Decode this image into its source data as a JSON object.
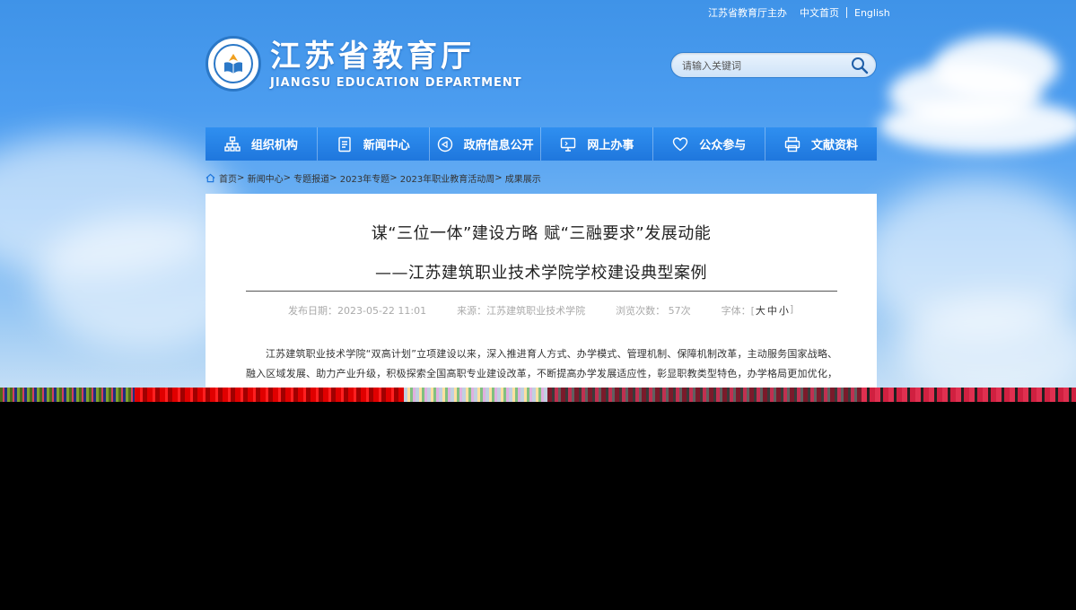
{
  "topbar": {
    "host": "江苏省教育厅主办",
    "chinese_home": "中文首页",
    "english": "English"
  },
  "logo": {
    "name_cn": "江苏省教育厅",
    "name_en": "JIANGSU EDUCATION DEPARTMENT"
  },
  "search": {
    "placeholder": "请输入关键词",
    "icon": "search-icon"
  },
  "nav": {
    "items": [
      {
        "label": "组织机构",
        "icon": "org-chart-icon"
      },
      {
        "label": "新闻中心",
        "icon": "document-icon"
      },
      {
        "label": "政府信息公开",
        "icon": "megaphone-icon"
      },
      {
        "label": "网上办事",
        "icon": "monitor-icon"
      },
      {
        "label": "公众参与",
        "icon": "heart-icon"
      },
      {
        "label": "文献资料",
        "icon": "printer-icon"
      }
    ]
  },
  "breadcrumb": {
    "items": [
      "首页",
      "新闻中心",
      "专题报道",
      "2023年专题",
      "2023年职业教育活动周",
      "成果展示"
    ],
    "separator": ">"
  },
  "article": {
    "title": "谋“三位一体”建设方略 赋“三融要求”发展动能",
    "subtitle": "——江苏建筑职业技术学院学校建设典型案例",
    "publish_date": "发布日期：2023-05-22 11:01",
    "source": "来源：江苏建筑职业技术学院",
    "views": "浏览次数： 57次",
    "font_label": "字体：[",
    "font_large": "大",
    "font_medium": "中",
    "font_small": "小",
    "font_close": "]",
    "body": "江苏建筑职业技术学院“双高计划”立项建设以来，深入推进育人方式、办学模式、管理机制、保障机制改革，主动服务国家战略、融入区域发展、助力产业升级，积极探索全国高职专业建设改革，不断提高办学发展适应性，彰显职教类型特色，办学格局更加优化，内涵条件持"
  },
  "colors": {
    "nav_bg": "#1f77dd",
    "sky_top": "#3f93e8",
    "logo_blue": "#2b78c7"
  }
}
